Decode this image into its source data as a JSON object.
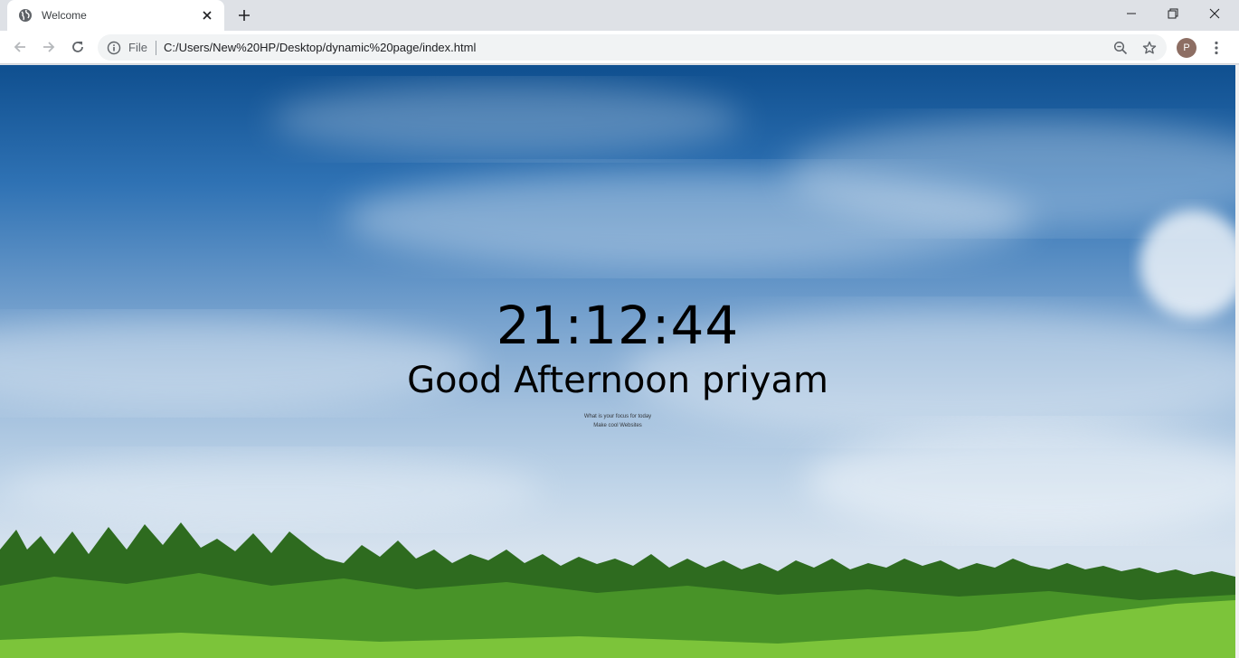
{
  "browser": {
    "tab": {
      "title": "Welcome",
      "favicon": "globe-icon"
    },
    "address_bar": {
      "scheme_label": "File",
      "url": "C:/Users/New%20HP/Desktop/dynamic%20page/index.html"
    },
    "profile": {
      "initial": "P",
      "color": "#8d6e63"
    }
  },
  "page": {
    "time": "21:12:44",
    "greeting": "Good Afternoon priyam",
    "focus_question": "What is your focus for today",
    "focus_answer": "Make cool Websites"
  },
  "colors": {
    "sky_top": "#0f4f8f",
    "sky_horizon": "#d6e2ee",
    "forest": "#2e6b1f",
    "meadow": "#7cc43a"
  }
}
